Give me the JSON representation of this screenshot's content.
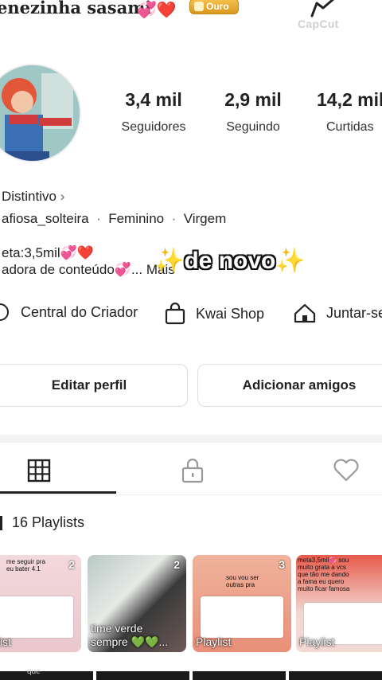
{
  "profile": {
    "username": "enezinha sasami",
    "username_hearts": "💞❤️",
    "badge": "Ouro"
  },
  "watermark": "CapCut",
  "stats": [
    {
      "value": "3,4 mil",
      "label": "Seguidores"
    },
    {
      "value": "2,9 mil",
      "label": "Seguindo"
    },
    {
      "value": "14,2 mil",
      "label": "Curtidas"
    }
  ],
  "distintivo": "Distintivo",
  "info_line": {
    "handle": "afiosa_solteira",
    "gender": "Feminino",
    "sign": "Virgem",
    "separator": "·"
  },
  "bio": {
    "line1": "eta:3,5mil💞❤️",
    "line2": "adora de conteúdo💞...",
    "more": "Mais"
  },
  "overlay_text": "de novo",
  "quick_links": [
    {
      "label": "Central do Criador",
      "icon": "creator-center-icon"
    },
    {
      "label": "Kwai Shop",
      "icon": "shopping-bag-icon"
    },
    {
      "label": "Juntar-se",
      "icon": "home-icon"
    }
  ],
  "buttons": {
    "edit": "Editar perfil",
    "add": "Adicionar amigos"
  },
  "tabs": [
    {
      "name": "grid",
      "icon": "grid-icon",
      "active": true
    },
    {
      "name": "private",
      "icon": "lock-icon",
      "active": false
    },
    {
      "name": "liked",
      "icon": "heart-icon",
      "active": false
    }
  ],
  "playlists": {
    "title": "16 Playlists",
    "cards": [
      {
        "count": "2",
        "caption": "aylist",
        "text": "me seguir pra eu bater 4.1"
      },
      {
        "count": "2",
        "caption": "time verde sempre 💚💚...",
        "text": ""
      },
      {
        "count": "3",
        "caption": "Playlist",
        "text": "sou vou ser outras pra"
      },
      {
        "count": "",
        "caption": "Playlist",
        "text": "meta3,5mil💞 sou muito grata a vcs que tão me dando a fama eu quero muito ficar famosa"
      }
    ]
  },
  "bottom_text": "que",
  "colors": {
    "accent": "#222222",
    "gold": "#e2a52e",
    "heart": "#e0123a",
    "pink": "#e64a9f"
  }
}
